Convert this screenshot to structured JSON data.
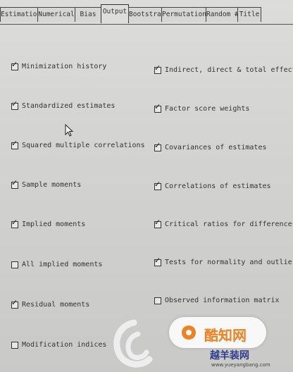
{
  "tabs": [
    {
      "label": "Estimation",
      "active": false
    },
    {
      "label": "Numerical",
      "active": false
    },
    {
      "label": "Bias",
      "active": false
    },
    {
      "label": "Output",
      "active": true
    },
    {
      "label": "Bootstrap",
      "active": false
    },
    {
      "label": "Permutations",
      "active": false
    },
    {
      "label": "Random #",
      "active": false
    },
    {
      "label": "Title",
      "active": false
    }
  ],
  "left_options": [
    {
      "label": "Minimization history",
      "checked": true
    },
    {
      "label": "Standardized estimates",
      "checked": true
    },
    {
      "label": "Squared multiple correlations",
      "checked": true
    },
    {
      "label": "Sample moments",
      "checked": true
    },
    {
      "label": "Implied moments",
      "checked": true
    },
    {
      "label": "All implied moments",
      "checked": false
    },
    {
      "label": "Residual moments",
      "checked": true
    },
    {
      "label": "Modification indices",
      "checked": false
    }
  ],
  "right_options": [
    {
      "label": "Indirect, direct & total effects",
      "checked": true
    },
    {
      "label": "Factor score weights",
      "checked": true
    },
    {
      "label": "Covariances of estimates",
      "checked": true
    },
    {
      "label": "Correlations of estimates",
      "checked": true
    },
    {
      "label": "Critical ratios for differences",
      "checked": true
    },
    {
      "label": "Tests for normality and outliers",
      "checked": true
    },
    {
      "label": "Observed information matrix",
      "checked": false
    }
  ],
  "check_glyph": "✓",
  "watermark": {
    "brand": "酷知网",
    "site": "越羊装网",
    "url": "www.yueyangbang.com"
  }
}
